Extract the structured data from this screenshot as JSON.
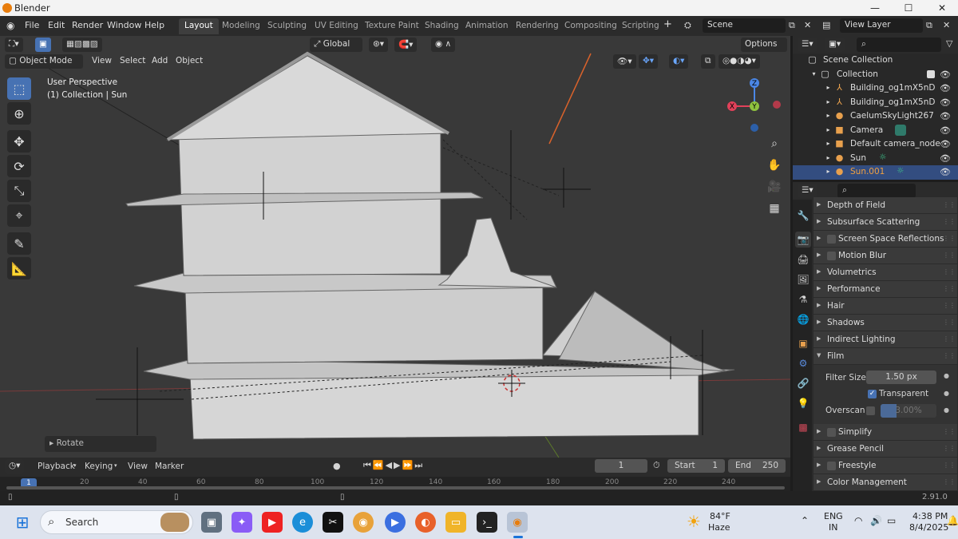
{
  "window": {
    "title": "Blender",
    "min": "—",
    "max": "☐",
    "close": "✕"
  },
  "menubar": {
    "items": [
      "File",
      "Edit",
      "Render",
      "Window",
      "Help"
    ],
    "tabs": [
      "Layout",
      "Modeling",
      "Sculpting",
      "UV Editing",
      "Texture Paint",
      "Shading",
      "Animation",
      "Rendering",
      "Compositing",
      "Scripting"
    ],
    "add_tab": "+",
    "scene": "Scene",
    "view_layer": "View Layer"
  },
  "viewport": {
    "mode": "Object Mode",
    "menus": [
      "View",
      "Select",
      "Add",
      "Object"
    ],
    "transform_orientation": "Global",
    "options": "Options",
    "info_line1": "User Perspective",
    "info_line2": "(1) Collection | Sun",
    "last_op": "Rotate",
    "gizmo": {
      "x": "X",
      "y": "Y",
      "z": "Z"
    }
  },
  "outliner": {
    "root": "Scene Collection",
    "collection": "Collection",
    "items": [
      {
        "name": "Building_og1mX5nD",
        "icon": "armature-icon",
        "color": "#e8a04d"
      },
      {
        "name": "Building_og1mX5nD",
        "icon": "armature-icon",
        "color": "#e8a04d"
      },
      {
        "name": "CaelumSkyLight267",
        "icon": "light-icon",
        "color": "#e8a04d"
      },
      {
        "name": "Camera",
        "icon": "camera-icon",
        "color": "#e8a04d"
      },
      {
        "name": "Default camera_node",
        "icon": "camera-icon",
        "color": "#e8a04d"
      },
      {
        "name": "Sun",
        "icon": "light-icon",
        "color": "#e8a04d"
      },
      {
        "name": "Sun.001",
        "icon": "light-icon",
        "color": "#e8a04d"
      }
    ]
  },
  "properties": {
    "panels": [
      {
        "label": "Depth of Field",
        "checkbox": false,
        "open": false
      },
      {
        "label": "Subsurface Scattering",
        "checkbox": false,
        "open": false
      },
      {
        "label": "Screen Space Reflections",
        "checkbox": true,
        "open": false
      },
      {
        "label": "Motion Blur",
        "checkbox": true,
        "open": false
      },
      {
        "label": "Volumetrics",
        "checkbox": false,
        "open": false
      },
      {
        "label": "Performance",
        "checkbox": false,
        "open": false
      },
      {
        "label": "Hair",
        "checkbox": false,
        "open": false
      },
      {
        "label": "Shadows",
        "checkbox": false,
        "open": false
      },
      {
        "label": "Indirect Lighting",
        "checkbox": false,
        "open": false
      },
      {
        "label": "Film",
        "checkbox": false,
        "open": true
      }
    ],
    "film": {
      "filter_size_label": "Filter Size",
      "filter_size": "1.50 px",
      "transparent_label": "Transparent",
      "overscan_label": "Overscan",
      "overscan": "3.00%"
    },
    "panels_after": [
      {
        "label": "Simplify",
        "checkbox": true
      },
      {
        "label": "Grease Pencil",
        "checkbox": false
      },
      {
        "label": "Freestyle",
        "checkbox": true
      },
      {
        "label": "Color Management",
        "checkbox": false
      }
    ]
  },
  "timeline": {
    "menus": [
      "Playback",
      "Keying",
      "View",
      "Marker"
    ],
    "current_frame": "1",
    "start_label": "Start",
    "start": "1",
    "end_label": "End",
    "end": "250",
    "ruler": [
      "20",
      "40",
      "60",
      "80",
      "100",
      "120",
      "140",
      "160",
      "180",
      "200",
      "220",
      "240"
    ],
    "frame_marker": "1"
  },
  "statusbar": {
    "version": "2.91.0"
  },
  "taskbar": {
    "search": "Search",
    "weather_temp": "84°F",
    "weather_desc": "Haze",
    "lang1": "ENG",
    "lang2": "IN",
    "time": "4:38 PM",
    "date": "8/4/2025"
  }
}
